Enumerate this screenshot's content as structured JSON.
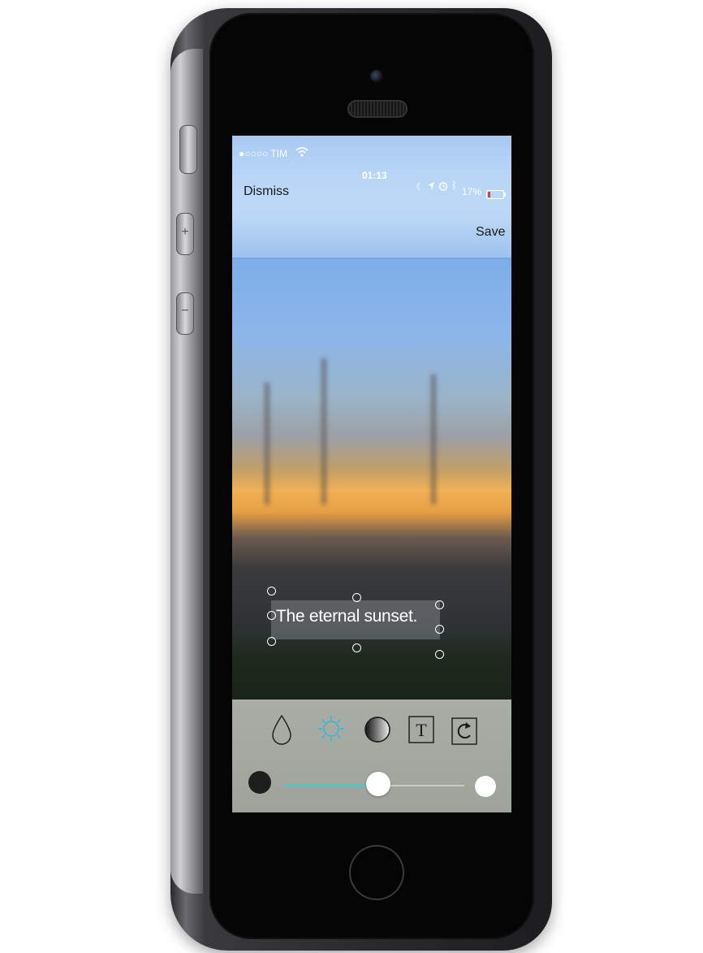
{
  "status_bar": {
    "carrier": "●○○○○ TIM",
    "time": "01:13",
    "battery_percent": "17%",
    "battery_level": 0.17
  },
  "nav": {
    "dismiss_label": "Dismiss",
    "save_label": "Save"
  },
  "caption": {
    "text": "The eternal sunset."
  },
  "tools": [
    {
      "icon": "drop-icon",
      "active": false
    },
    {
      "icon": "brightness-icon",
      "active": true
    },
    {
      "icon": "contrast-icon",
      "active": false
    },
    {
      "icon": "text-icon",
      "label": "T",
      "active": false
    },
    {
      "icon": "rotate-icon",
      "active": false
    }
  ],
  "slider": {
    "value": 0.52,
    "accent_color": "#2fd0df"
  },
  "colors": {
    "active_tool": "#2fb8d8"
  }
}
